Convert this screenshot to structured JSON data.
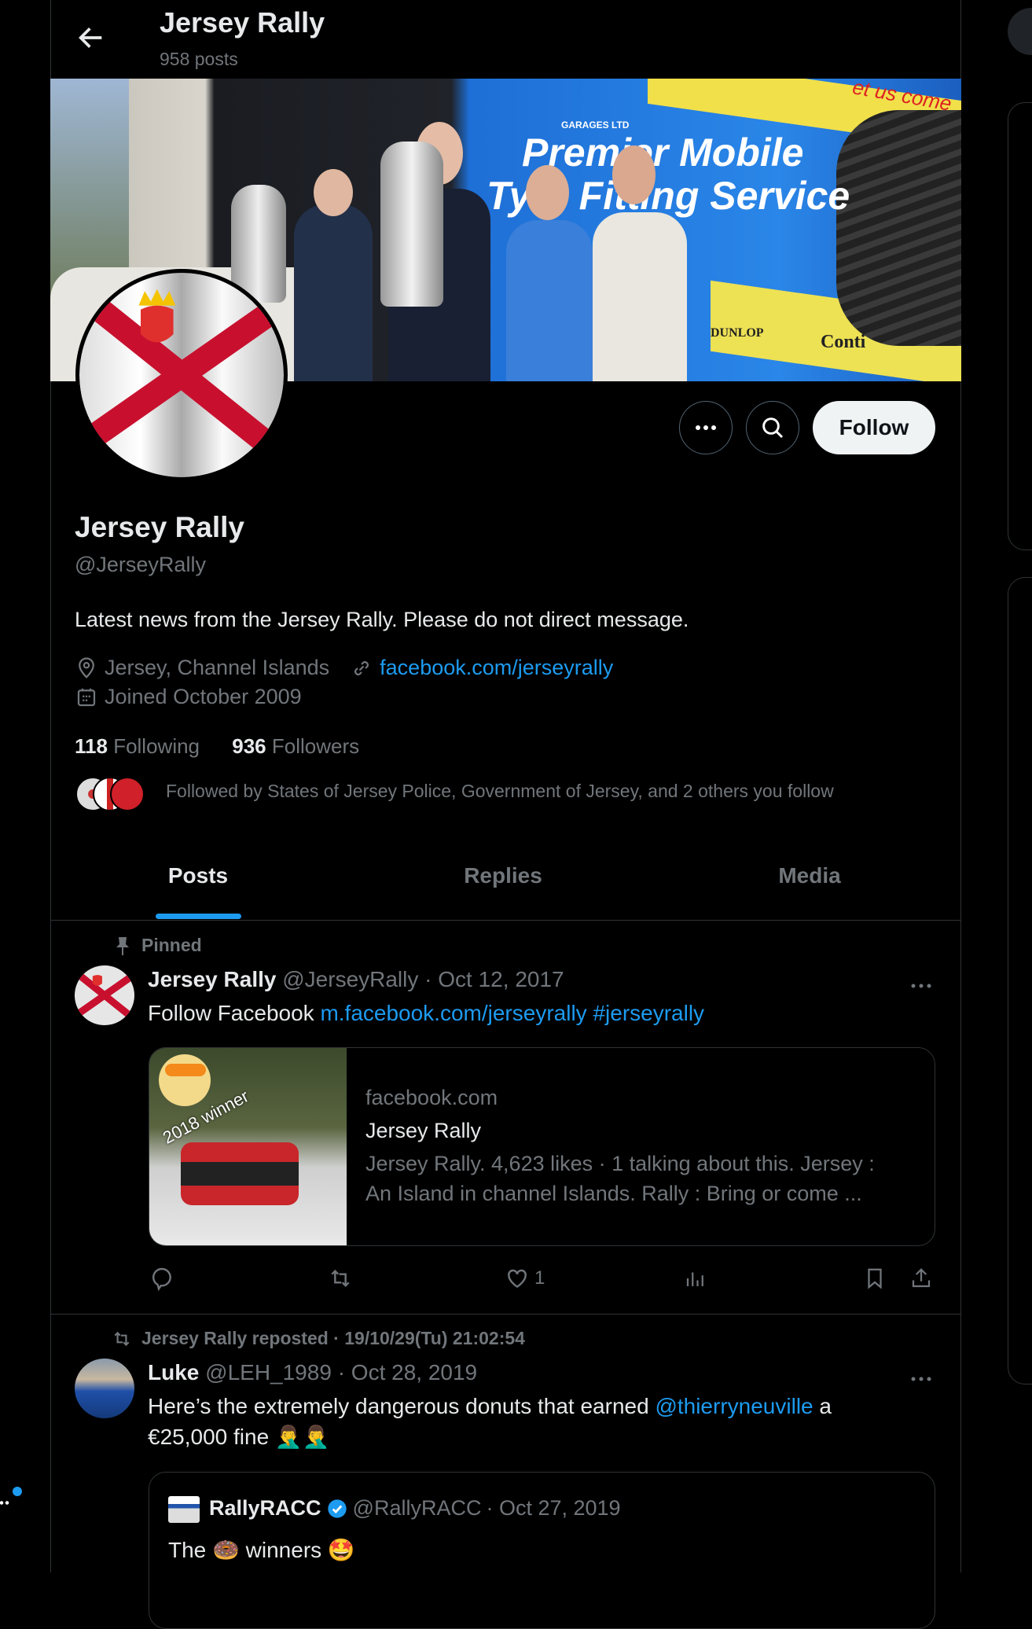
{
  "header": {
    "title": "Jersey Rally",
    "posts": "958 posts"
  },
  "profile": {
    "name": "Jersey Rally",
    "handle": "@JerseyRally",
    "bio": "Latest news from the Jersey Rally. Please do not direct message.",
    "location": "Jersey, Channel Islands",
    "website": "facebook.com/jerseyrally",
    "joined": "Joined October 2009",
    "following_count": "118",
    "following_label": "Following",
    "followers_count": "936",
    "followers_label": "Followers",
    "followed_by": "Followed by States of Jersey Police, Government of Jersey, and 2 others you follow",
    "follow_label": "Follow"
  },
  "banner": {
    "text_top": "et us come",
    "text_brand": "GARAGES LTD",
    "text_line1": "Premier Mobile",
    "text_line2": "Tyre Fitting Service",
    "text_dunlop": "DUNLOP",
    "text_conti": "Conti"
  },
  "tabs": [
    {
      "label": "Posts",
      "active": true
    },
    {
      "label": "Replies"
    },
    {
      "label": "Media"
    }
  ],
  "posts": [
    {
      "context": "Pinned",
      "name": "Jersey Rally",
      "handle": "@JerseyRally",
      "date": "· Oct 12, 2017",
      "text": "Follow Facebook ",
      "link": "m.facebook.com/jerseyrally",
      "hashtag": "#jerseyrally",
      "card": {
        "image_caption": "2018 winner",
        "domain": "facebook.com",
        "title": "Jersey Rally",
        "desc1": "Jersey Rally. 4,623 likes · 1 talking about this. Jersey :",
        "desc2": "An Island in channel Islands. Rally : Bring or come ..."
      },
      "likes": "1"
    },
    {
      "context": "Jersey Rally reposted · 19/10/29(Tu) 21:02:54",
      "name": "Luke",
      "handle": "@LEH_1989",
      "date": "· Oct 28, 2019",
      "text1": "Here’s the extremely dangerous donuts that earned ",
      "mention": "@thierryneuville",
      "text1b": " a",
      "text2": "€25,000 fine 🤦‍♂️🤦‍♂️",
      "quote": {
        "name": "RallyRACC",
        "handle": "@RallyRACC",
        "date": "· Oct 27, 2019",
        "text": "The 🍩 winners 🤩"
      }
    }
  ],
  "colors": {
    "accent": "#1d9bf0",
    "muted": "#71767b",
    "border": "#2f3336"
  }
}
